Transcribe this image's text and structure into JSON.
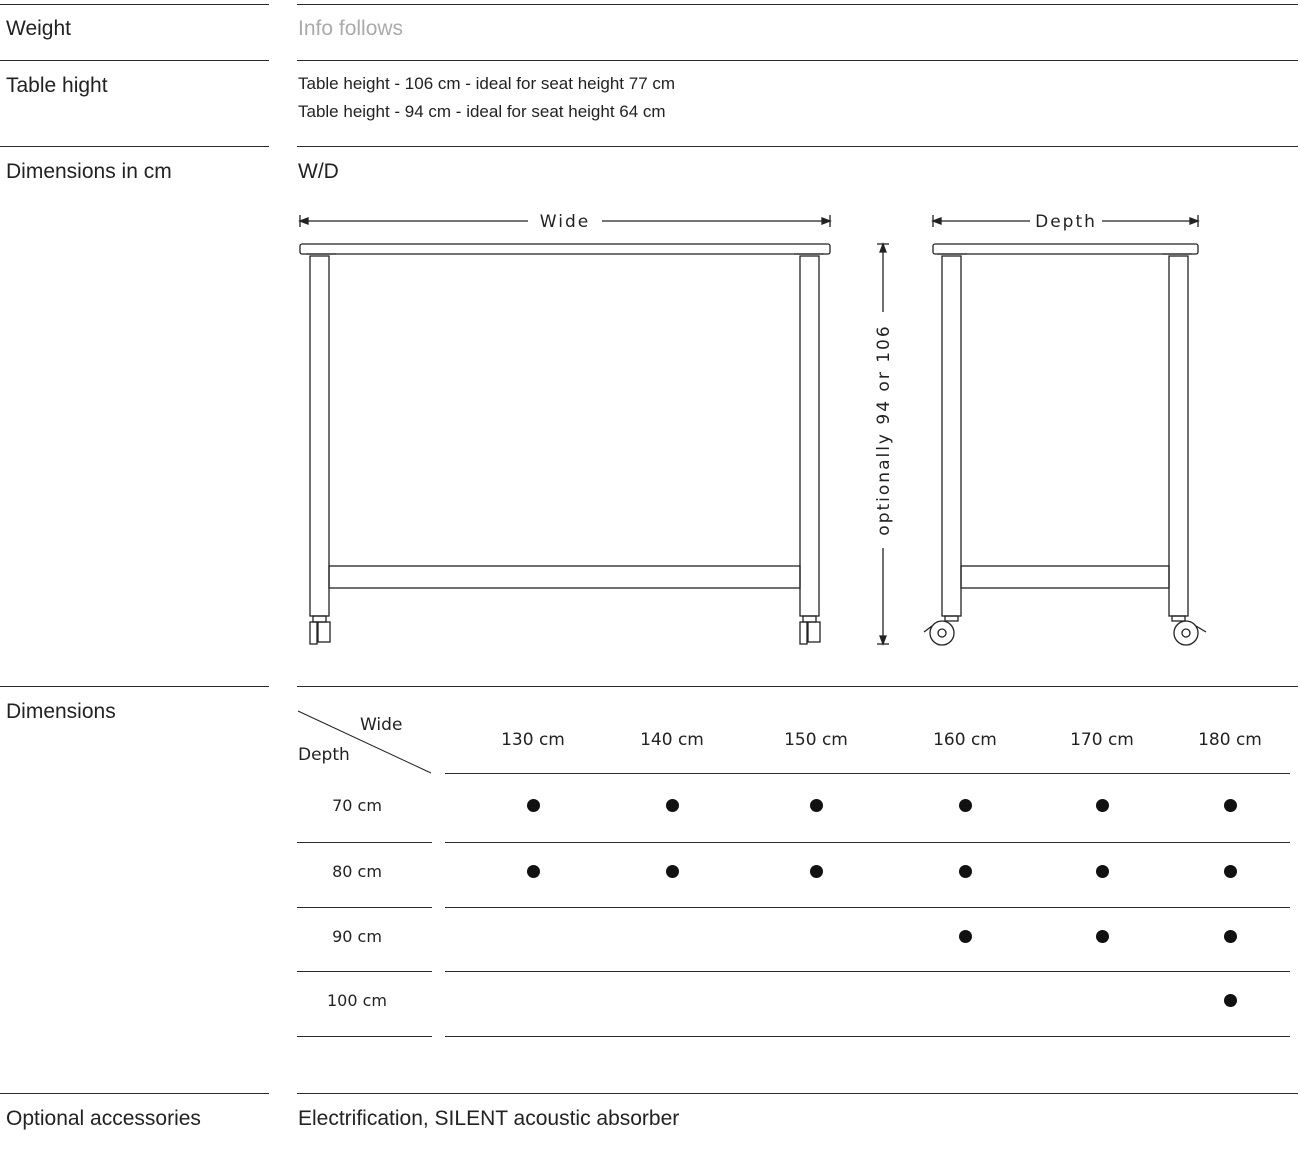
{
  "rows": {
    "weight": {
      "label": "Weight",
      "value": "Info follows"
    },
    "table_height": {
      "label": "Table hight",
      "lines": [
        "Table height - 106 cm - ideal for seat height 77 cm",
        "Table height - 94 cm - ideal for seat height 64 cm"
      ]
    },
    "dimensions_cm": {
      "label": "Dimensions in cm",
      "value": "W/D",
      "drawing": {
        "wide_label": "Wide",
        "depth_label": "Depth",
        "height_label": "optionally 94 or 106"
      }
    },
    "dimensions": {
      "label": "Dimensions",
      "corner_wide": "Wide",
      "corner_depth": "Depth",
      "widths": [
        "130 cm",
        "140 cm",
        "150 cm",
        "160 cm",
        "170 cm",
        "180 cm"
      ],
      "depths": [
        "70 cm",
        "80 cm",
        "90 cm",
        "100 cm"
      ],
      "availability": [
        [
          true,
          true,
          true,
          true,
          true,
          true
        ],
        [
          true,
          true,
          true,
          true,
          true,
          true
        ],
        [
          false,
          false,
          false,
          true,
          true,
          true
        ],
        [
          false,
          false,
          false,
          false,
          false,
          true
        ]
      ]
    },
    "accessories": {
      "label": "Optional accessories",
      "value": "Electrification, SILENT acoustic absorber"
    }
  }
}
